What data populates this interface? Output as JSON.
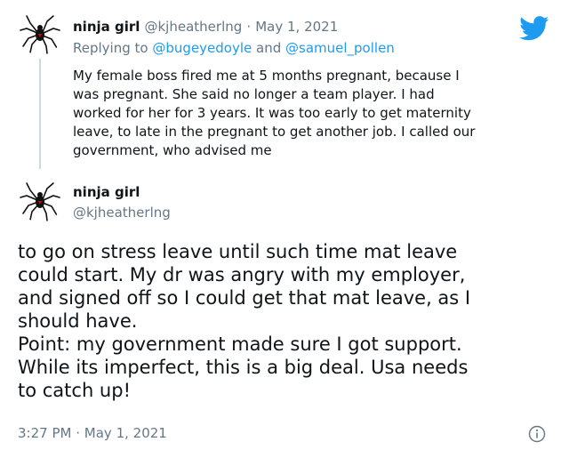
{
  "tweet1": {
    "display_name": "ninja girl",
    "handle": "@kjheatherlng",
    "separator": "·",
    "date": "May 1, 2021",
    "reply_prefix": "Replying to",
    "reply_to_1": "@bugeyedoyle",
    "reply_and": "and",
    "reply_to_2": "@samuel_pollen",
    "text_lines": [
      "My female boss fired me at 5 months pregnant, because I",
      "was pregnant.  She said no longer a team player.  I had",
      "worked for her for 3 years.  It was too early to get maternity",
      "leave, to late in the pregnant to get another job.  I called our",
      "government, who advised me"
    ]
  },
  "tweet2": {
    "display_name": "ninja girl",
    "handle": "@kjheatherlng",
    "text_lines": [
      "to go on stress leave until such time mat leave",
      "could start.  My dr was angry with my employer,",
      "and signed off so I could get that mat leave, as I",
      "should have.",
      "Point: my government made sure I got support.",
      "While its imperfect, this is a big deal.  Usa needs",
      "to catch up!"
    ],
    "time": "3:27 PM",
    "separator": "·",
    "date": "May 1, 2021"
  },
  "colors": {
    "twitter_blue": "#1d9bf0",
    "muted_gray": "#657786",
    "text": "#0f1419"
  },
  "icons": {
    "brand": "twitter-bird-icon",
    "info": "info-icon",
    "avatar": "spider-avatar"
  }
}
